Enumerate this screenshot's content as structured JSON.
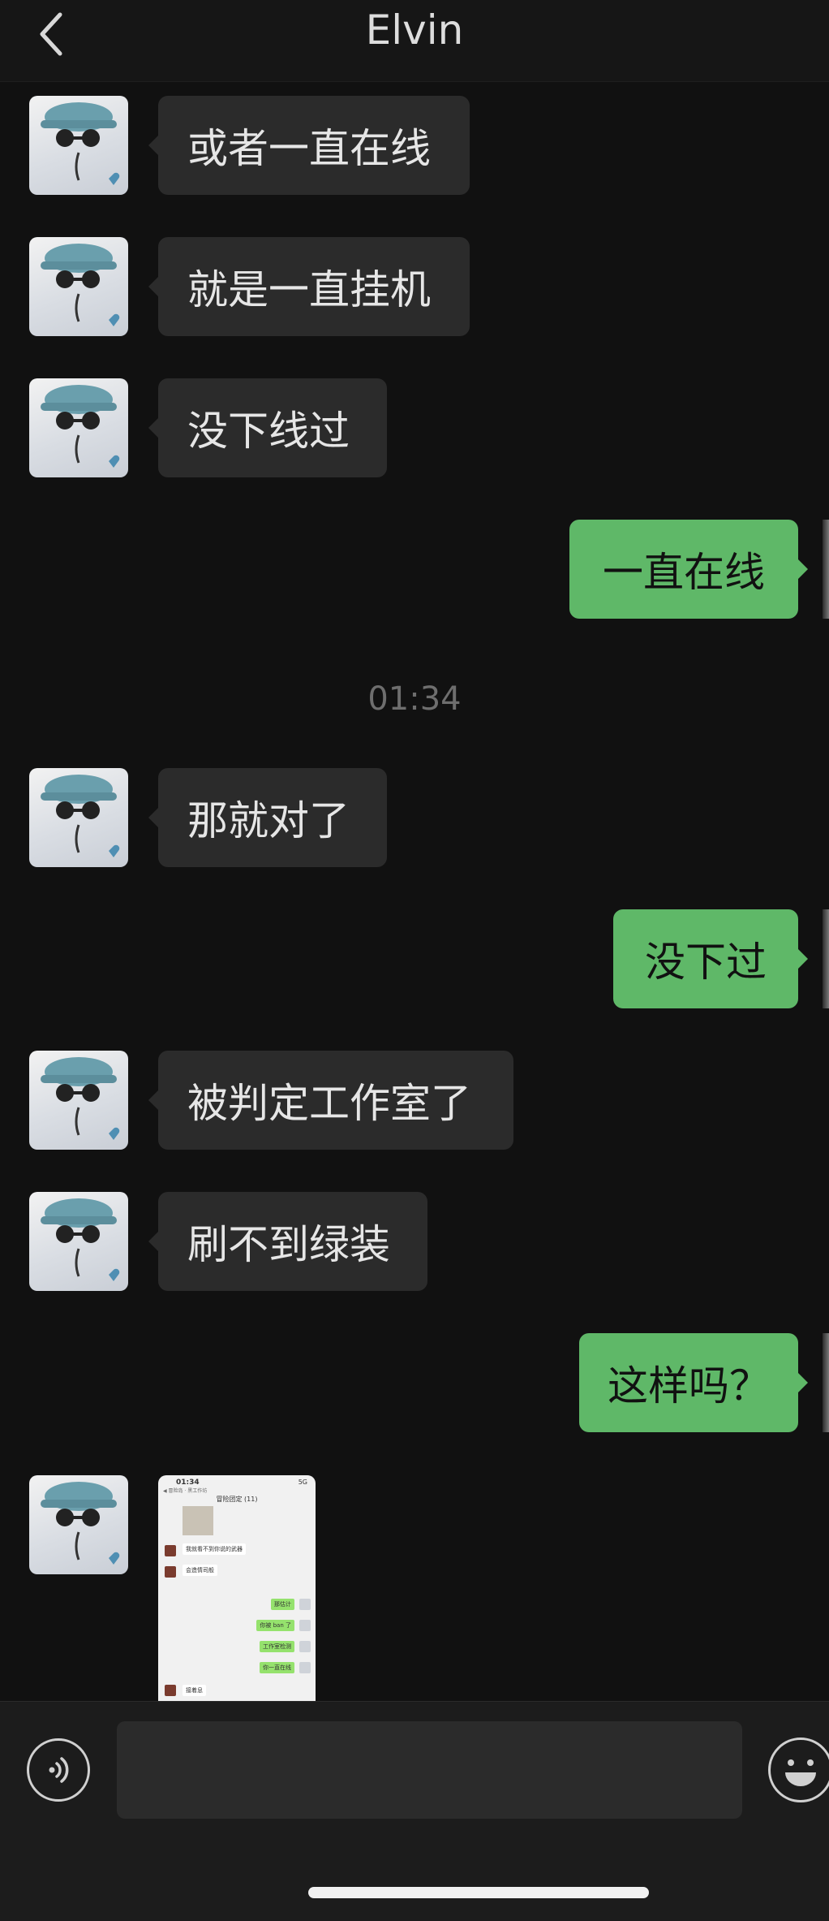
{
  "header": {
    "title": "Elvin"
  },
  "messages": [
    {
      "side": "in",
      "text": "或者一直在线"
    },
    {
      "side": "in",
      "text": "就是一直挂机"
    },
    {
      "side": "in",
      "text": "没下线过"
    },
    {
      "side": "out",
      "text": "一直在线"
    },
    {
      "side": "time",
      "text": "01:34"
    },
    {
      "side": "in",
      "text": "那就对了"
    },
    {
      "side": "out",
      "text": "没下过"
    },
    {
      "side": "in",
      "text": "被判定工作室了"
    },
    {
      "side": "in",
      "text": "刷不到绿装"
    },
    {
      "side": "out",
      "text": "这样吗？"
    }
  ],
  "thumbnail": {
    "status_time": "01:34",
    "status_right": "5G",
    "sub": "◀ 冒险岛 · 黑工作坊",
    "title": "冒险团定 (11)",
    "rows": [
      {
        "side": "in",
        "text": "我就看不到你说的武器"
      },
      {
        "side": "in",
        "text": "会造情司般"
      },
      {
        "side": "out",
        "text": "那估计"
      },
      {
        "side": "out",
        "text": "你被 ban 了"
      },
      {
        "side": "out",
        "text": "工作室检测"
      },
      {
        "side": "out",
        "text": "你一直在线"
      },
      {
        "side": "in",
        "text": "接着息"
      }
    ]
  },
  "composer": {
    "value": "",
    "placeholder": ""
  }
}
